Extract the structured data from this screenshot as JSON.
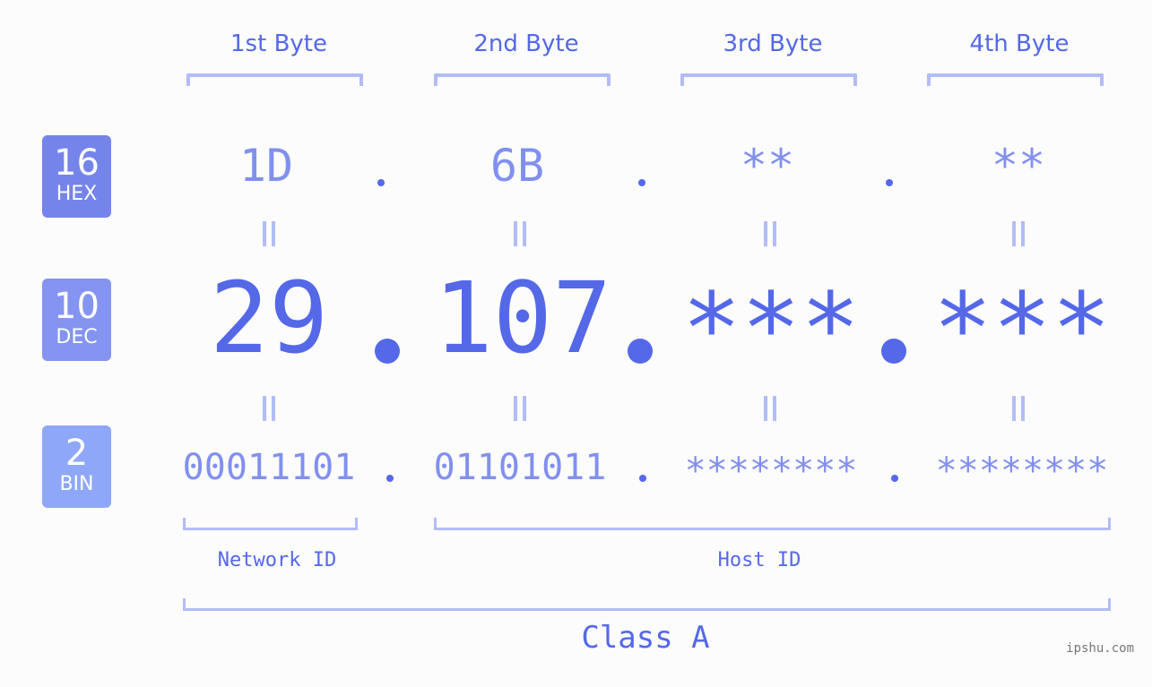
{
  "byte_headers": [
    "1st Byte",
    "2nd Byte",
    "3rd Byte",
    "4th Byte"
  ],
  "badges": {
    "hex": {
      "number": "16",
      "label": "HEX",
      "color": "#7584ea"
    },
    "dec": {
      "number": "10",
      "label": "DEC",
      "color": "#8494f0"
    },
    "bin": {
      "number": "2",
      "label": "BIN",
      "color": "#8fa7f8"
    }
  },
  "hex_values": [
    "1D",
    "6B",
    "**",
    "**"
  ],
  "dec_values": [
    "29",
    "107",
    "***",
    "***"
  ],
  "bin_values": [
    "00011101",
    "01101011",
    "********",
    "********"
  ],
  "separator": ".",
  "equals_symbol": "=",
  "segments": {
    "network_label": "Network ID",
    "host_label": "Host ID"
  },
  "class_label": "Class A",
  "watermark": "ipshu.com",
  "colors": {
    "accent": "#5468e8",
    "light_accent": "#8190ef",
    "bracket": "#b2bcf7",
    "background": "#fbfcfb"
  }
}
